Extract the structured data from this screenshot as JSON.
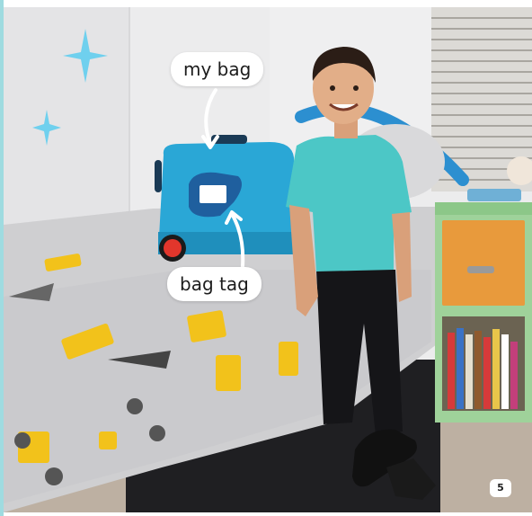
{
  "labels": {
    "bag_label": "my bag",
    "tag_label": "bag tag"
  },
  "page_number": "5",
  "colors": {
    "wall": "#ebebec",
    "suitcase": "#2aa7d6",
    "shirt": "#4cc7c6",
    "bedspread": "#cfcfd1",
    "nightstand": "#9fd29a",
    "drawer": "#e89a3c",
    "sparkle": "#6fd0ee",
    "floor": "#b8a898"
  },
  "icons": [
    "sparkle-icon"
  ]
}
